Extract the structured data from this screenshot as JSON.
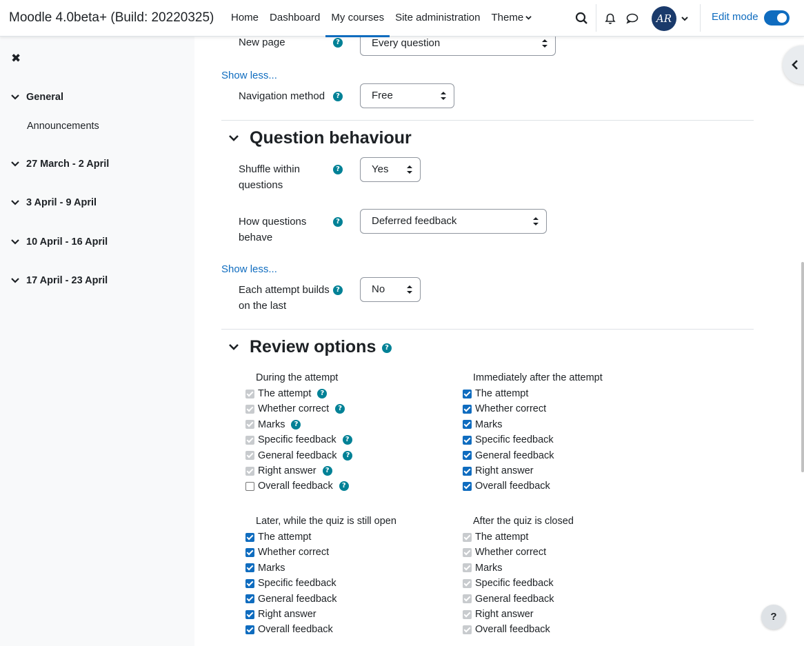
{
  "navbar": {
    "brand": "Moodle 4.0beta+ (Build: 20220325)",
    "links": [
      {
        "label": "Home",
        "active": false
      },
      {
        "label": "Dashboard",
        "active": false
      },
      {
        "label": "My courses",
        "active": true
      },
      {
        "label": "Site administration",
        "active": false
      },
      {
        "label": "Theme",
        "active": false
      }
    ],
    "avatar_initials": "AR",
    "edit_mode_label": "Edit mode",
    "edit_mode_on": true,
    "icons": [
      "search-icon",
      "bell-icon",
      "chat-icon",
      "chevron-down-icon"
    ]
  },
  "drawer": {
    "close_icon": "close-icon",
    "sections": [
      {
        "label": "General",
        "items": [
          "Announcements"
        ]
      },
      {
        "label": "27 March - 2 April",
        "items": []
      },
      {
        "label": "3 April - 9 April",
        "items": []
      },
      {
        "label": "10 April - 16 April",
        "items": []
      },
      {
        "label": "17 April - 23 April",
        "items": []
      }
    ]
  },
  "form": {
    "new_page": {
      "label": "New page",
      "value": "Every question"
    },
    "show_less_1": "Show less...",
    "navigation_method": {
      "label": "Navigation method",
      "value": "Free"
    },
    "question_behaviour": {
      "heading": "Question behaviour",
      "shuffle": {
        "label_line1": "Shuffle within",
        "label_line2": "questions",
        "value": "Yes"
      },
      "how_behave": {
        "label_line1": "How questions",
        "label_line2": "behave",
        "value": "Deferred feedback"
      },
      "show_less": "Show less...",
      "each_attempt": {
        "label_line1": "Each attempt builds",
        "label_line2": "on the last",
        "value": "No"
      }
    },
    "review_options": {
      "heading": "Review options",
      "columns": [
        {
          "title": "During the attempt",
          "items": [
            {
              "label": "The attempt",
              "state": "disabled",
              "help": true
            },
            {
              "label": "Whether correct",
              "state": "disabled",
              "help": true
            },
            {
              "label": "Marks",
              "state": "disabled",
              "help": true
            },
            {
              "label": "Specific feedback",
              "state": "disabled",
              "help": true
            },
            {
              "label": "General feedback",
              "state": "disabled",
              "help": true
            },
            {
              "label": "Right answer",
              "state": "disabled",
              "help": true
            },
            {
              "label": "Overall feedback",
              "state": "unchecked",
              "help": true
            }
          ]
        },
        {
          "title": "Immediately after the attempt",
          "items": [
            {
              "label": "The attempt",
              "state": "checked"
            },
            {
              "label": "Whether correct",
              "state": "checked"
            },
            {
              "label": "Marks",
              "state": "checked"
            },
            {
              "label": "Specific feedback",
              "state": "checked"
            },
            {
              "label": "General feedback",
              "state": "checked"
            },
            {
              "label": "Right answer",
              "state": "checked"
            },
            {
              "label": "Overall feedback",
              "state": "checked"
            }
          ]
        },
        {
          "title": "Later, while the quiz is still open",
          "items": [
            {
              "label": "The attempt",
              "state": "checked"
            },
            {
              "label": "Whether correct",
              "state": "checked"
            },
            {
              "label": "Marks",
              "state": "checked"
            },
            {
              "label": "Specific feedback",
              "state": "checked"
            },
            {
              "label": "General feedback",
              "state": "checked"
            },
            {
              "label": "Right answer",
              "state": "checked"
            },
            {
              "label": "Overall feedback",
              "state": "checked"
            }
          ]
        },
        {
          "title": "After the quiz is closed",
          "items": [
            {
              "label": "The attempt",
              "state": "disabled"
            },
            {
              "label": "Whether correct",
              "state": "disabled"
            },
            {
              "label": "Marks",
              "state": "disabled"
            },
            {
              "label": "Specific feedback",
              "state": "disabled"
            },
            {
              "label": "General feedback",
              "state": "disabled"
            },
            {
              "label": "Right answer",
              "state": "disabled"
            },
            {
              "label": "Overall feedback",
              "state": "disabled"
            }
          ]
        }
      ]
    }
  },
  "help_fab": "?",
  "colors": {
    "primary": "#0f6cbf",
    "help": "#008196",
    "disabled": "#c8cbce"
  }
}
